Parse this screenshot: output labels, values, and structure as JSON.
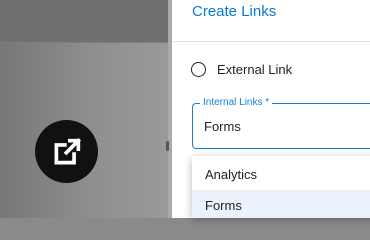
{
  "panel": {
    "title": "Create Links",
    "external_link_option": {
      "label": "External Link",
      "selected": false
    },
    "internal_links_field": {
      "label": "Internal Links *",
      "value": "Forms",
      "options": [
        "Analytics",
        "Forms"
      ],
      "highlighted_option": "Forms"
    }
  },
  "overlay_badge": {
    "icon": "open-in-new-icon"
  },
  "colors": {
    "accent": "#0b78d0",
    "field_border": "#1a7fd4",
    "badge_background": "#111111",
    "option_highlight": "#eaf2fb"
  }
}
